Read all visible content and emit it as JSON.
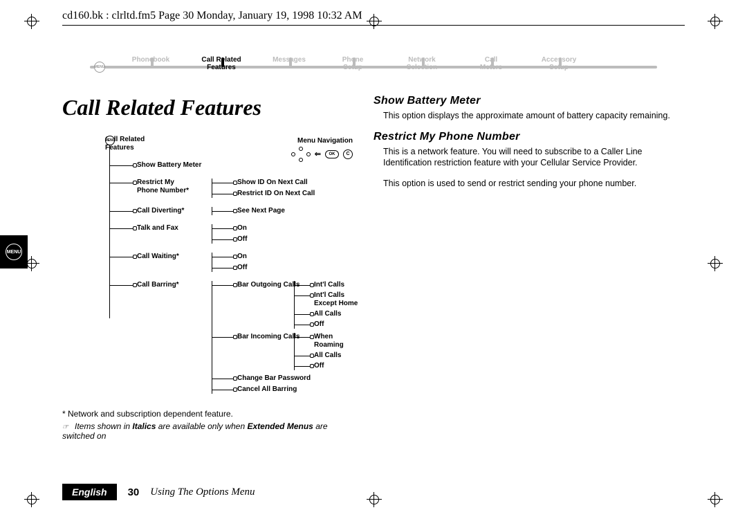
{
  "header": "cd160.bk : clrltd.fm5  Page 30  Monday, January 19, 1998  10:32 AM",
  "nav": {
    "menu_icon_label": "MENU",
    "items": [
      {
        "label": "Phonebook",
        "active": false
      },
      {
        "label": "Call Related\nFeatures",
        "active": true
      },
      {
        "label": "Messages",
        "active": false
      },
      {
        "label": "Phone\nSetup",
        "active": false
      },
      {
        "label": "Network\nSelection",
        "active": false
      },
      {
        "label": "Call\nMeters",
        "active": false
      },
      {
        "label": "Accessory\nSetup",
        "active": false
      }
    ]
  },
  "title": "Call Related Features",
  "menu_nav_label": "Menu Navigation",
  "nav_keys": {
    "ok": "OK",
    "c": "C",
    "arrow": "⇐"
  },
  "tree": {
    "root_icon": "MENU",
    "root": "Call Related\nFeatures",
    "items": [
      {
        "label": "Show Battery Meter"
      },
      {
        "label": "Restrict My\nPhone Number*",
        "children": [
          "Show ID On Next Call",
          "Restrict ID On Next Call"
        ]
      },
      {
        "label": "Call Diverting*",
        "children": [
          "See Next Page"
        ]
      },
      {
        "label": "Talk and Fax",
        "children": [
          "On",
          "Off"
        ]
      },
      {
        "label": "Call Waiting*",
        "children": [
          "On",
          "Off"
        ]
      },
      {
        "label": "Call Barring*",
        "children_complex": [
          {
            "label": "Bar Outgoing Calls",
            "children": [
              "Int'l Calls",
              "Int'l Calls Except Home",
              "All Calls",
              "Off"
            ]
          },
          {
            "label": "Bar Incoming Calls",
            "children": [
              "When Roaming",
              "All Calls",
              "Off"
            ]
          },
          {
            "label": "Change Bar Password"
          },
          {
            "label": "Cancel All Barring"
          }
        ]
      }
    ]
  },
  "notes": {
    "line1": "*  Network and subscription dependent feature.",
    "line2_pre": "Items shown in ",
    "line2_b1": "Italics",
    "line2_mid": " are available only when ",
    "line2_b2": "Extended Menus",
    "line2_post": " are switched on",
    "hand": "☞"
  },
  "sections": [
    {
      "heading": "Show Battery Meter",
      "paras": [
        "This option displays the approximate amount of battery capacity remaining."
      ]
    },
    {
      "heading": "Restrict My Phone Number",
      "paras": [
        "This is a network feature. You will need to subscribe to a Caller Line Identification restriction feature with your Cellular Service Provider.",
        "This option is used to send or restrict sending your phone number."
      ]
    }
  ],
  "sidetab_icon": "MENU",
  "footer": {
    "lang": "English",
    "page": "30",
    "section": "Using The Options Menu"
  }
}
